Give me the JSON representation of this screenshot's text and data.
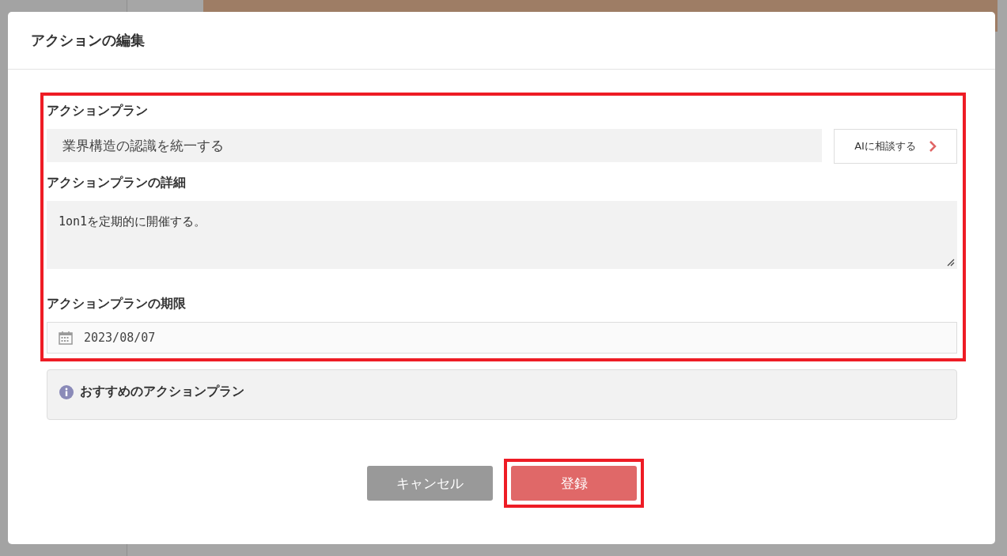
{
  "dialog": {
    "title": "アクションの編集"
  },
  "fields": [
    {
      "kind": "text",
      "label": "アクションプラン",
      "value": "業界構造の認識を統一する",
      "button": "AIに相談する"
    },
    {
      "kind": "textarea",
      "label": "アクションプランの詳細",
      "value": "1on1を定期的に開催する。"
    },
    {
      "kind": "date",
      "label": "アクションプランの期限",
      "value": "2023/08/07"
    }
  ],
  "recommendation": {
    "title": "おすすめのアクションプラン"
  },
  "buttons": [
    {
      "kind": "cancel",
      "label": "キャンセル"
    },
    {
      "kind": "submit",
      "label": "登録"
    }
  ],
  "highlights": {
    "form": true,
    "submit_button": true
  }
}
